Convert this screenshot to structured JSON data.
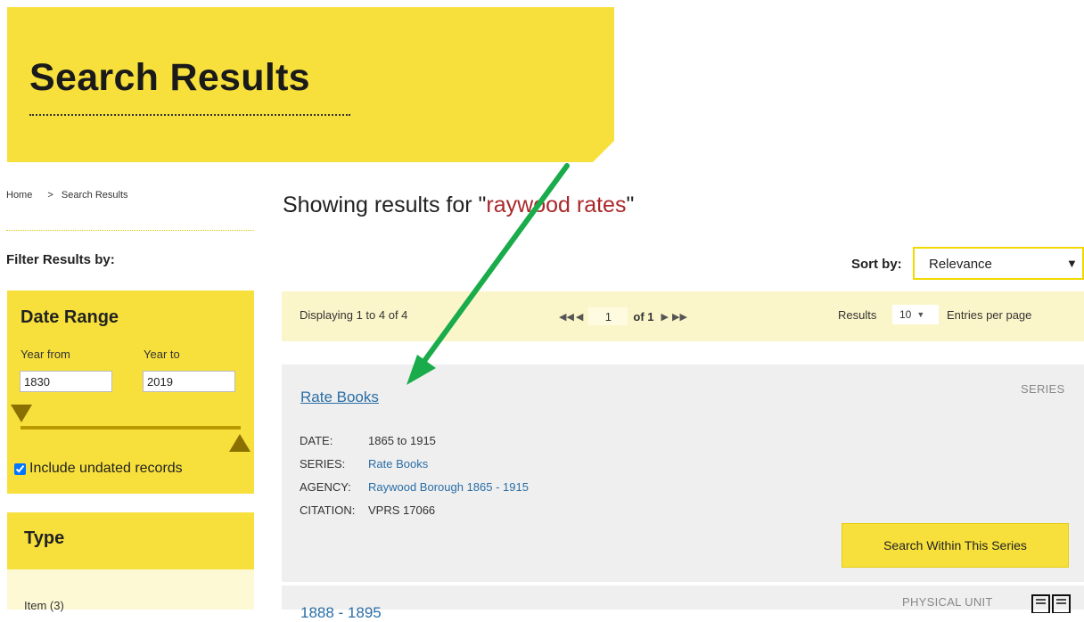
{
  "banner": {
    "title": "Search Results"
  },
  "breadcrumb": {
    "home": "Home",
    "separator": ">",
    "current": "Search Results"
  },
  "sidebar": {
    "filter_title": "Filter Results by:",
    "date_range": {
      "title": "Date Range",
      "year_from_label": "Year from",
      "year_to_label": "Year to",
      "year_from_value": "1830",
      "year_to_value": "2019",
      "include_undated_label": "Include undated records",
      "include_undated_checked": true
    },
    "type": {
      "title": "Type",
      "items": [
        "Item (3)"
      ]
    }
  },
  "main": {
    "showing_prefix": "Showing results for \"",
    "query": "raywood rates",
    "showing_suffix": "\"",
    "sort_label": "Sort by:",
    "sort_value": "Relevance",
    "pager": {
      "displaying": "Displaying 1 to 4 of 4",
      "page": "1",
      "of": "of 1",
      "results_label": "Results",
      "per_page": "10",
      "entries_label": "Entries per page"
    },
    "results": [
      {
        "title": "Rate Books",
        "type": "SERIES",
        "date_label": "DATE:",
        "date_value": "1865 to 1915",
        "series_label": "SERIES:",
        "series_value": "Rate Books",
        "agency_label": "AGENCY:",
        "agency_value": "Raywood Borough 1865 - 1915",
        "citation_label": "CITATION:",
        "citation_value": "VPRS 17066",
        "action": "Search Within This Series"
      },
      {
        "title": "1888 - 1895",
        "type": "PHYSICAL UNIT"
      }
    ]
  },
  "annotation": {
    "arrow_color": "#1aab4a"
  },
  "colors": {
    "brand_yellow": "#f7e03c",
    "link_blue": "#2a6ea6",
    "query_red": "#a9282a"
  }
}
